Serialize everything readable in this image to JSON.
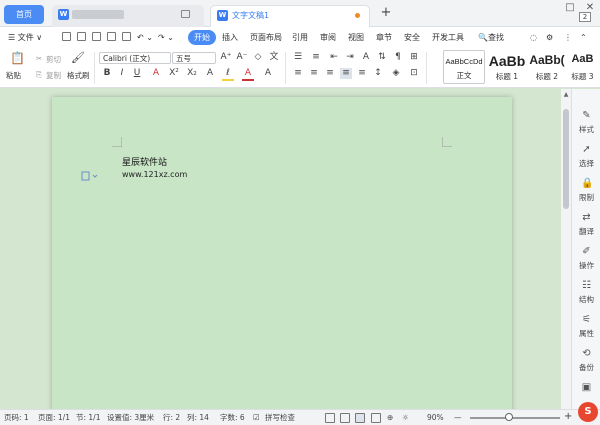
{
  "tabs": {
    "home_label": "首页",
    "doc_label": "文字文稿1",
    "new_tab": "+"
  },
  "window": {
    "restore": "□",
    "menu": "⋮",
    "close": "✕",
    "badge": "2"
  },
  "menubar": {
    "file": "☰ 文件 ∨",
    "start": "开始",
    "items": [
      "插入",
      "页面布局",
      "引用",
      "审阅",
      "视图",
      "章节",
      "安全",
      "开发工具"
    ],
    "search": "🔍查找"
  },
  "ribbon": {
    "paste": "粘贴",
    "cut": "剪切",
    "copy": "复制",
    "format_painter": "格式刷",
    "font_name": "Calibri (正文)",
    "font_size": "五号",
    "bold": "B",
    "italic": "I",
    "underline": "U",
    "strike": "A",
    "grow": "A⁺",
    "shrink": "A⁻",
    "clear": "◇",
    "styles": [
      {
        "sample": "AaBbCcDd",
        "name": "正文"
      },
      {
        "sample": "AaBb",
        "name": "标题 1"
      },
      {
        "sample": "AaBb(",
        "name": "标题 2"
      },
      {
        "sample": "AaB",
        "name": "标题 3"
      }
    ]
  },
  "document": {
    "line1": "星辰软件站",
    "line2": "www.121xz.com"
  },
  "right_panel": {
    "items": [
      "样式",
      "选择",
      "限制",
      "翻译",
      "操作",
      "结构",
      "属性",
      "备份"
    ]
  },
  "statusbar": {
    "page_no": "页码: 1",
    "pages": "页面: 1/1",
    "section": "节: 1/1",
    "setting": "设置值: 3厘米",
    "row": "行: 2",
    "col": "列: 14",
    "words": "字数: 6",
    "spell": "拼写检查",
    "zoom": "90%",
    "zoom_minus": "—",
    "zoom_plus": "+",
    "logo": "S"
  },
  "colors": {
    "accent": "#4b8bf4",
    "page_bg": "#c8e5c6",
    "workspace_bg": "#d4e6d0"
  }
}
